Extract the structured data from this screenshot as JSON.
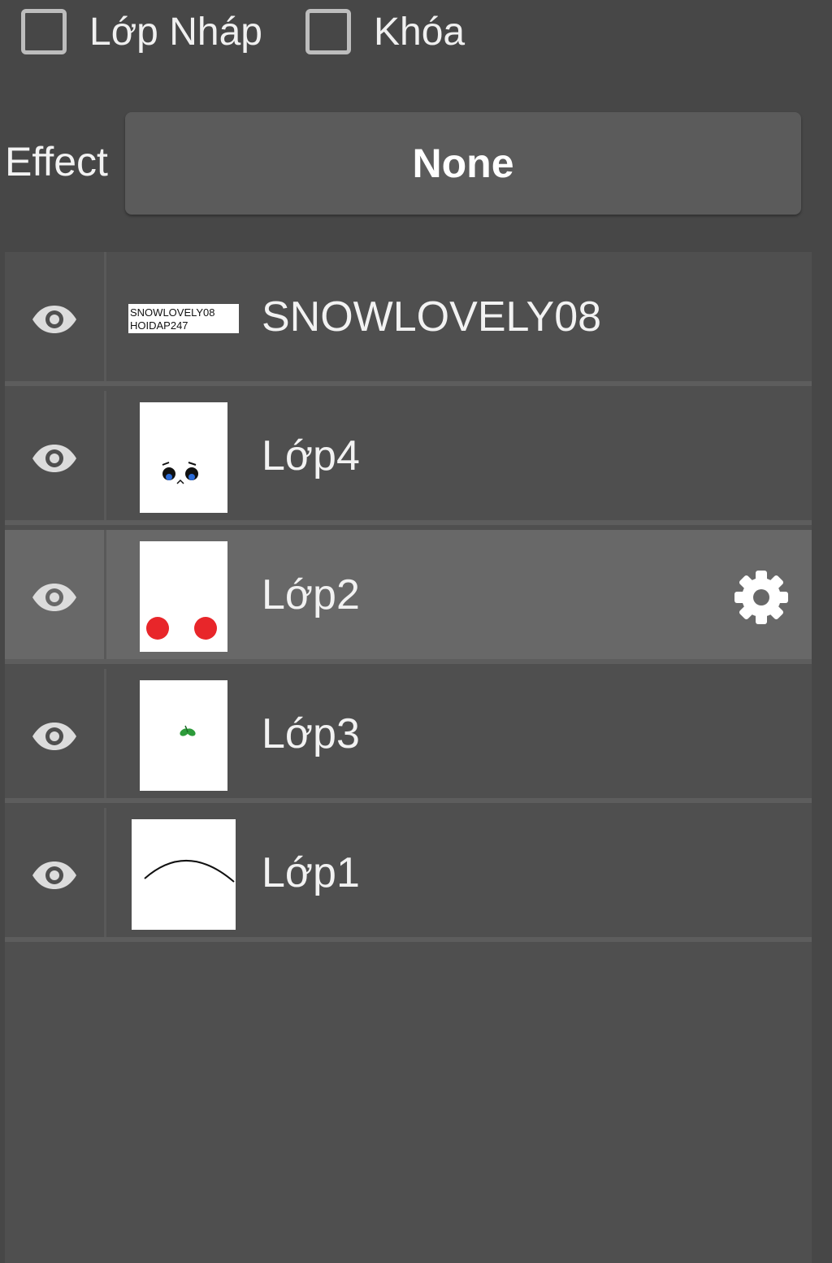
{
  "options": {
    "draft_label": "Lớp Nháp",
    "lock_label": "Khóa"
  },
  "effect": {
    "label": "Effect",
    "value": "None"
  },
  "layers": [
    {
      "name": "SNOWLOVELY08",
      "thumb_text_1": "SNOWLOVELY08",
      "thumb_text_2": "HOIDAP247",
      "visible": true,
      "selected": false
    },
    {
      "name": "Lớp4",
      "visible": true,
      "selected": false
    },
    {
      "name": "Lớp2",
      "visible": true,
      "selected": true
    },
    {
      "name": "Lớp3",
      "visible": true,
      "selected": false
    },
    {
      "name": "Lớp1",
      "visible": true,
      "selected": false
    }
  ],
  "icons": {
    "eye": "eye-icon",
    "gear": "gear-icon"
  },
  "colors": {
    "panel_bg": "#474747",
    "row_bg": "#4f4f4f",
    "row_selected_bg": "#686868",
    "effect_button_bg": "#5b5b5b"
  }
}
